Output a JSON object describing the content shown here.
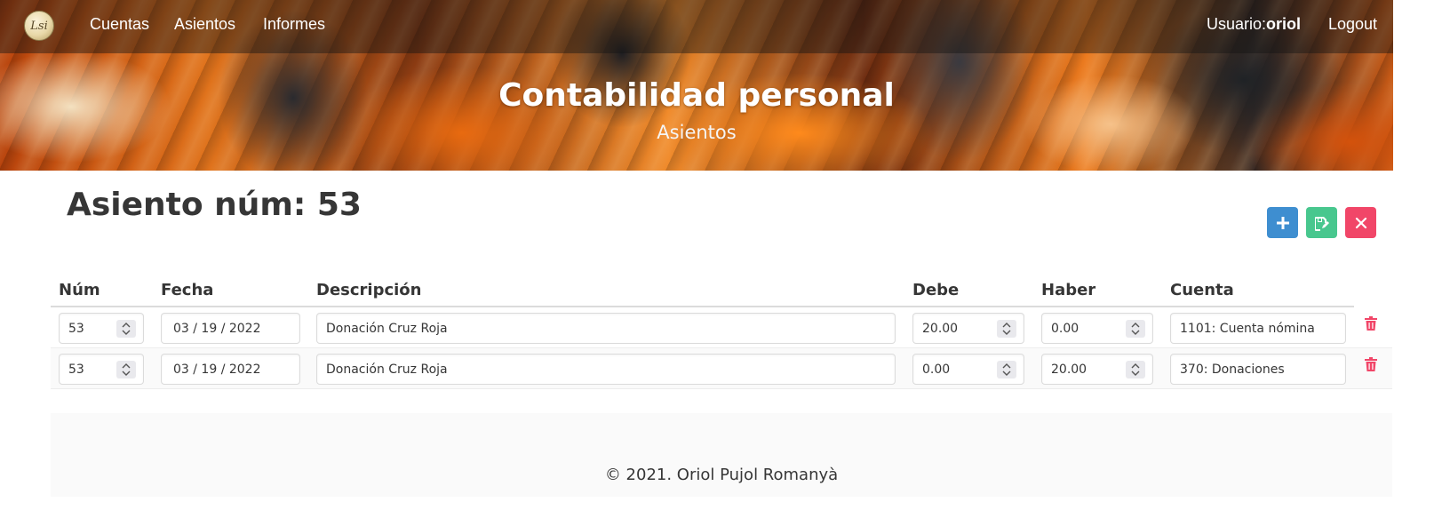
{
  "navbar": {
    "logo_text": "Lsi",
    "links": [
      {
        "label": "Cuentas"
      },
      {
        "label": "Asientos"
      },
      {
        "label": "Informes"
      }
    ],
    "user_prefix": "Usuario:",
    "user_name": "oriol",
    "logout_label": "Logout"
  },
  "hero": {
    "title": "Contabilidad personal",
    "subtitle": "Asientos"
  },
  "page": {
    "title": "Asiento núm: 53"
  },
  "actions": {
    "add_icon": "plus-icon",
    "save_icon": "save-edit-icon",
    "close_icon": "close-icon",
    "colors": {
      "add": "#3e8ed0",
      "save": "#48c78e",
      "close": "#f14668"
    }
  },
  "table": {
    "headers": {
      "num": "Núm",
      "fecha": "Fecha",
      "descripcion": "Descripción",
      "debe": "Debe",
      "haber": "Haber",
      "cuenta": "Cuenta"
    },
    "rows": [
      {
        "num": "53",
        "fecha": "03 / 19 / 2022",
        "descripcion": "Donación Cruz Roja",
        "debe": "20.00",
        "haber": "0.00",
        "cuenta": "1101: Cuenta nómina"
      },
      {
        "num": "53",
        "fecha": "03 / 19 / 2022",
        "descripcion": "Donación Cruz Roja",
        "debe": "0.00",
        "haber": "20.00",
        "cuenta": "370: Donaciones"
      }
    ],
    "delete_icon": "trash-icon",
    "delete_color": "#f14668"
  },
  "footer": {
    "text": "© 2021. Oriol Pujol Romanyà"
  }
}
